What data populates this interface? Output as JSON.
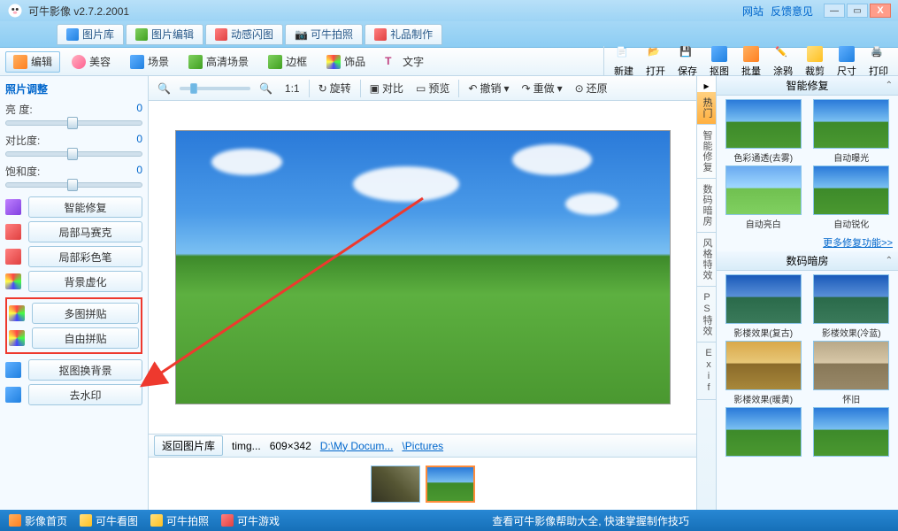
{
  "title": "可牛影像  v2.7.2.2001",
  "title_links": {
    "website": "网站",
    "feedback": "反馈意见"
  },
  "main_tabs": [
    "图片库",
    "图片编辑",
    "动感闪图",
    "可牛拍照",
    "礼品制作"
  ],
  "tool_tabs": [
    "编辑",
    "美容",
    "场景",
    "高清场景",
    "边框",
    "饰品",
    "文字"
  ],
  "tool_actions": [
    "新建",
    "打开",
    "保存",
    "抠图",
    "批量",
    "涂鸦",
    "裁剪",
    "尺寸",
    "打印"
  ],
  "left": {
    "title": "照片调整",
    "brightness_label": "亮  度:",
    "brightness_val": "0",
    "contrast_label": "对比度:",
    "contrast_val": "0",
    "saturation_label": "饱和度:",
    "saturation_val": "0",
    "tools": [
      "智能修复",
      "局部马赛克",
      "局部彩色笔",
      "背景虚化"
    ],
    "highlighted": [
      "多图拼贴",
      "自由拼贴"
    ],
    "tools2": [
      "抠图换背景",
      "去水印"
    ]
  },
  "canvas_tb": {
    "ratio": "1:1",
    "rotate": "旋转",
    "compare": "对比",
    "preview": "预览",
    "undo": "撤销",
    "redo": "重做",
    "restore": "还原"
  },
  "canvas_bottom": {
    "return": "返回图片库",
    "filename": "timg...",
    "dims": "609×342",
    "path1": "D:\\My Docum...",
    "path2": "\\Pictures"
  },
  "right": {
    "vtabs": [
      "热门",
      "智能修复",
      "数码暗房",
      "风格特效",
      "PS特效",
      "Exif"
    ],
    "sec1": "智能修复",
    "effects1": [
      "色彩通透(去雾)",
      "自动曝光",
      "自动亮白",
      "自动锐化"
    ],
    "more": "更多修复功能>>",
    "sec2": "数码暗房",
    "effects2": [
      "影楼效果(复古)",
      "影楼效果(冷蓝)",
      "影楼效果(暖黄)",
      "怀旧"
    ]
  },
  "status": {
    "home": "影像首页",
    "view": "可牛看图",
    "cam": "可牛拍照",
    "game": "可牛游戏",
    "help": "查看可牛影像帮助大全, 快速掌握制作技巧"
  }
}
